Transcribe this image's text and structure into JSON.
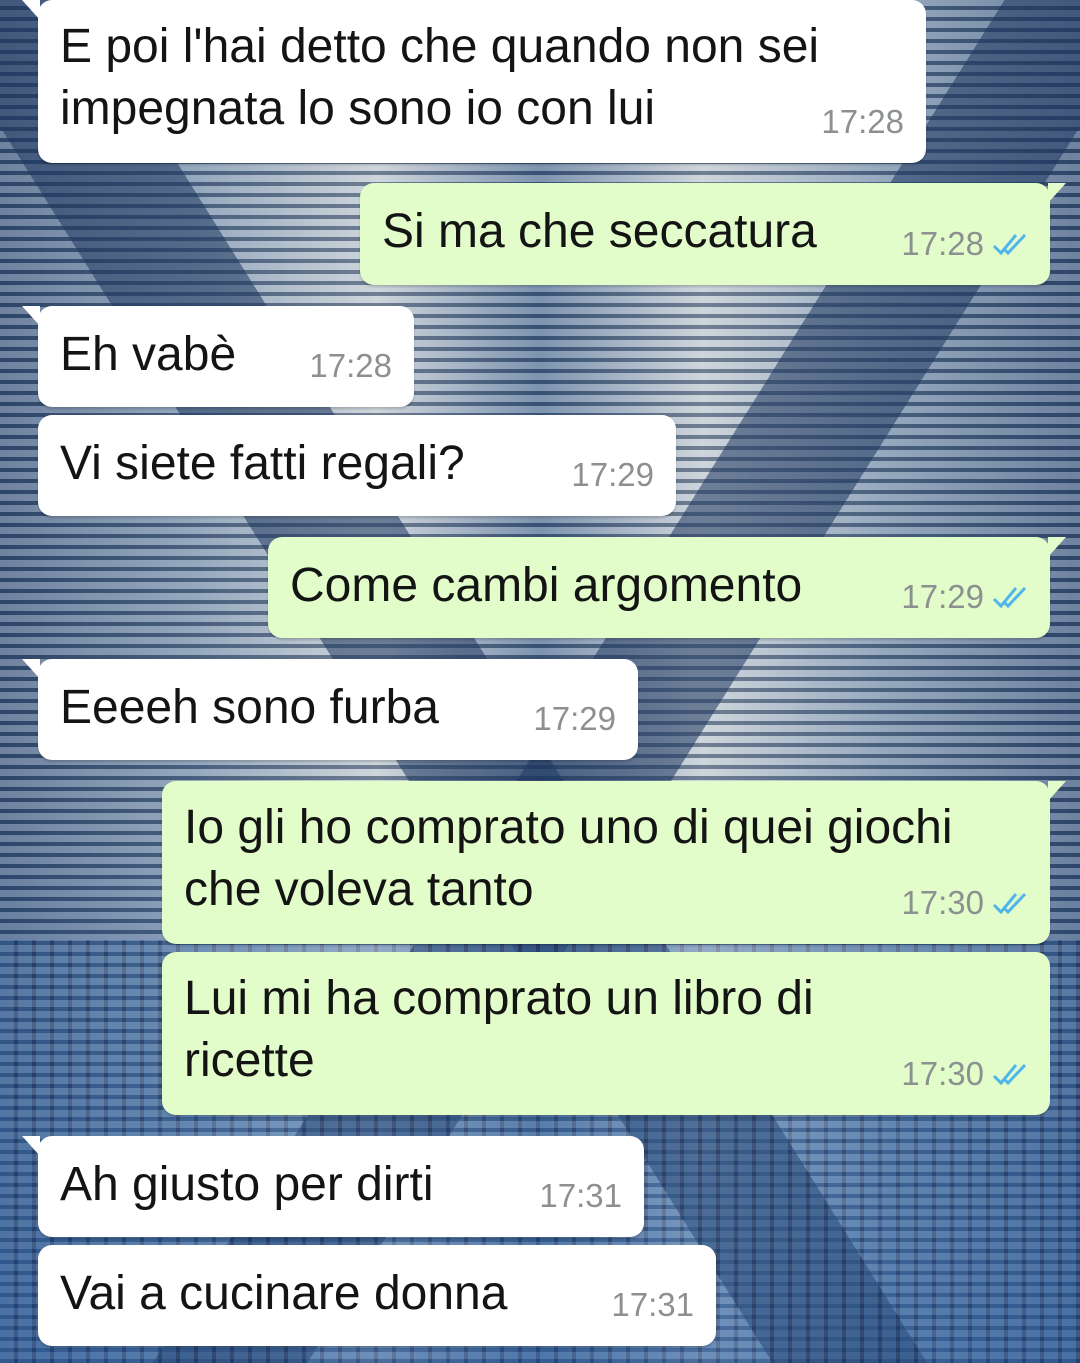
{
  "colors": {
    "incoming_bubble": "#ffffff",
    "outgoing_bubble": "#e2fdc9",
    "timestamp": "#8c9090",
    "read_ticks": "#4fb6ec",
    "text": "#141414"
  },
  "messages": [
    {
      "direction": "in",
      "text": "E poi l'hai detto che quando non sei\nimpegnata lo sono io con lui",
      "time": "17:28",
      "ticks": null
    },
    {
      "direction": "out",
      "text": "Si ma che seccatura",
      "time": "17:28",
      "ticks": "read-ticks-icon"
    },
    {
      "direction": "in",
      "text": "Eh vabè",
      "time": "17:28",
      "ticks": null
    },
    {
      "direction": "in",
      "text": "Vi siete fatti regali?",
      "time": "17:29",
      "ticks": null
    },
    {
      "direction": "out",
      "text": "Come cambi argomento",
      "time": "17:29",
      "ticks": "read-ticks-icon"
    },
    {
      "direction": "in",
      "text": "Eeeeh sono furba",
      "time": "17:29",
      "ticks": null
    },
    {
      "direction": "out",
      "text": "Io gli ho comprato uno di quei giochi\nche voleva tanto",
      "time": "17:30",
      "ticks": "read-ticks-icon"
    },
    {
      "direction": "out",
      "text": "Lui mi ha comprato un libro di\nricette",
      "time": "17:30",
      "ticks": "read-ticks-icon"
    },
    {
      "direction": "in",
      "text": "Ah giusto per dirti",
      "time": "17:31",
      "ticks": null
    },
    {
      "direction": "in",
      "text": "Vai a cucinare donna",
      "time": "17:31",
      "ticks": null
    }
  ]
}
